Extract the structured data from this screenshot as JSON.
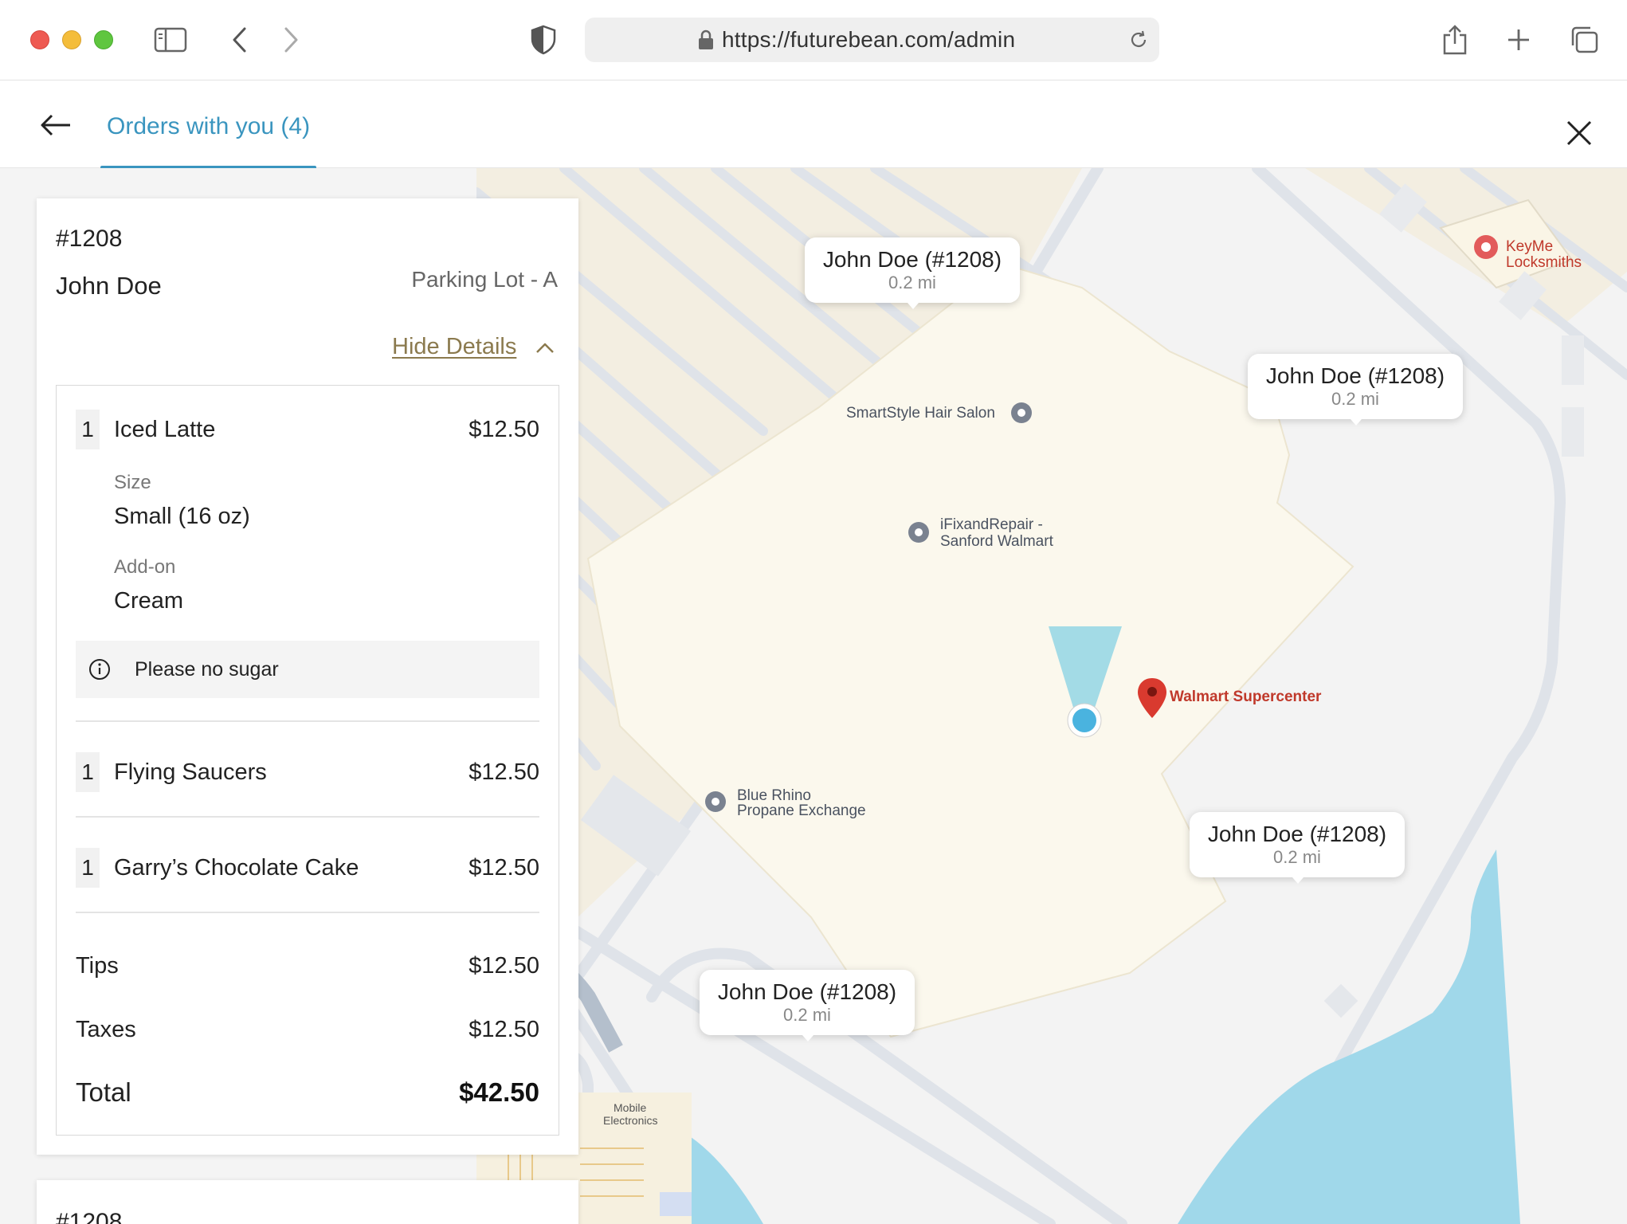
{
  "browser": {
    "url": "https://futurebean.com/admin"
  },
  "header": {
    "tab_label": "Orders with you (4)"
  },
  "order": {
    "number": "#1208",
    "customer": "John Doe",
    "location": "Parking Lot - A",
    "toggle_label": "Hide Details",
    "items": [
      {
        "qty": "1",
        "name": "Iced Latte",
        "price": "$12.50",
        "options": [
          {
            "label": "Size",
            "value": "Small (16 oz)"
          },
          {
            "label": "Add-on",
            "value": "Cream"
          }
        ],
        "note": "Please no sugar"
      },
      {
        "qty": "1",
        "name": "Flying Saucers",
        "price": "$12.50"
      },
      {
        "qty": "1",
        "name": "Garry’s Chocolate Cake",
        "price": "$12.50"
      }
    ],
    "tips_label": "Tips",
    "tips_value": "$12.50",
    "taxes_label": "Taxes",
    "taxes_value": "$12.50",
    "total_label": "Total",
    "total_value": "$42.50"
  },
  "next_order": {
    "number": "#1208"
  },
  "map": {
    "places": {
      "smartstyle": "SmartStyle Hair Salon",
      "ifix_line1": "iFixandRepair -",
      "ifix_line2": "Sanford Walmart",
      "walmart": "Walmart Supercenter",
      "bluerhino_line1": "Blue Rhino",
      "bluerhino_line2": "Propane Exchange",
      "keyme": "KeyMe Locksmiths",
      "mobile_line1": "Mobile",
      "mobile_line2": "Electronics"
    },
    "callouts": [
      {
        "name": "John Doe (#1208)",
        "distance": "0.2 mi"
      },
      {
        "name": "John Doe (#1208)",
        "distance": "0.2 mi"
      },
      {
        "name": "John Doe (#1208)",
        "distance": "0.2 mi"
      },
      {
        "name": "John Doe (#1208)",
        "distance": "0.2 mi"
      }
    ]
  },
  "colors": {
    "accent": "#3a95bf",
    "link": "#8b7a4e",
    "water": "#a0d8ea",
    "building": "#fbf8ed",
    "pin": "#d93a2f"
  }
}
